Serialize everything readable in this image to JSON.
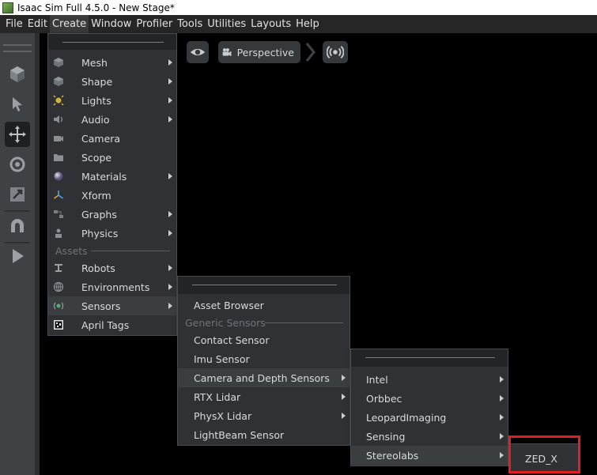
{
  "window": {
    "title": "Isaac Sim Full 4.5.0 - New Stage*"
  },
  "menubar": {
    "items": [
      "File",
      "Edit",
      "Create",
      "Window",
      "Profiler",
      "Tools",
      "Utilities",
      "Layouts",
      "Help"
    ]
  },
  "viewport": {
    "camera_label": "Perspective"
  },
  "create_menu": {
    "items": [
      {
        "label": "Mesh",
        "icon": "cube-icon",
        "submenu": true
      },
      {
        "label": "Shape",
        "icon": "shape-icon",
        "submenu": true
      },
      {
        "label": "Lights",
        "icon": "light-icon",
        "submenu": true
      },
      {
        "label": "Audio",
        "icon": "speaker-icon",
        "submenu": true
      },
      {
        "label": "Camera",
        "icon": "camera-icon",
        "submenu": false
      },
      {
        "label": "Scope",
        "icon": "folder-icon",
        "submenu": false
      },
      {
        "label": "Materials",
        "icon": "sphere-icon",
        "submenu": true
      },
      {
        "label": "Xform",
        "icon": "axes-icon",
        "submenu": false
      },
      {
        "label": "Graphs",
        "icon": "graph-icon",
        "submenu": true
      },
      {
        "label": "Physics",
        "icon": "physics-icon",
        "submenu": true
      }
    ],
    "assets_section": "Assets",
    "asset_items": [
      {
        "label": "Robots",
        "icon": "robot-icon",
        "submenu": true
      },
      {
        "label": "Environments",
        "icon": "globe-icon",
        "submenu": true
      },
      {
        "label": "Sensors",
        "icon": "sensor-icon",
        "submenu": true
      },
      {
        "label": "April Tags",
        "icon": "apriltag-icon",
        "submenu": false
      }
    ]
  },
  "sensors_menu": {
    "asset_browser": "Asset Browser",
    "section": "Generic Sensors",
    "items": [
      {
        "label": "Contact Sensor",
        "submenu": false
      },
      {
        "label": "Imu Sensor",
        "submenu": false
      },
      {
        "label": "Camera and Depth Sensors",
        "submenu": true
      },
      {
        "label": "RTX Lidar",
        "submenu": true
      },
      {
        "label": "PhysX Lidar",
        "submenu": true
      },
      {
        "label": "LightBeam Sensor",
        "submenu": false
      }
    ]
  },
  "camera_depth_menu": {
    "items": [
      {
        "label": "Intel",
        "submenu": true
      },
      {
        "label": "Orbbec",
        "submenu": true
      },
      {
        "label": "LeopardImaging",
        "submenu": true
      },
      {
        "label": "Sensing",
        "submenu": true
      },
      {
        "label": "Stereolabs",
        "submenu": true
      }
    ]
  },
  "stereolabs_menu": {
    "items": [
      {
        "label": "ZED_X"
      }
    ]
  },
  "colors": {
    "highlight_box": "#e02020",
    "menu_bg": "#2f3134",
    "toolbar_bg": "#3f4244"
  }
}
